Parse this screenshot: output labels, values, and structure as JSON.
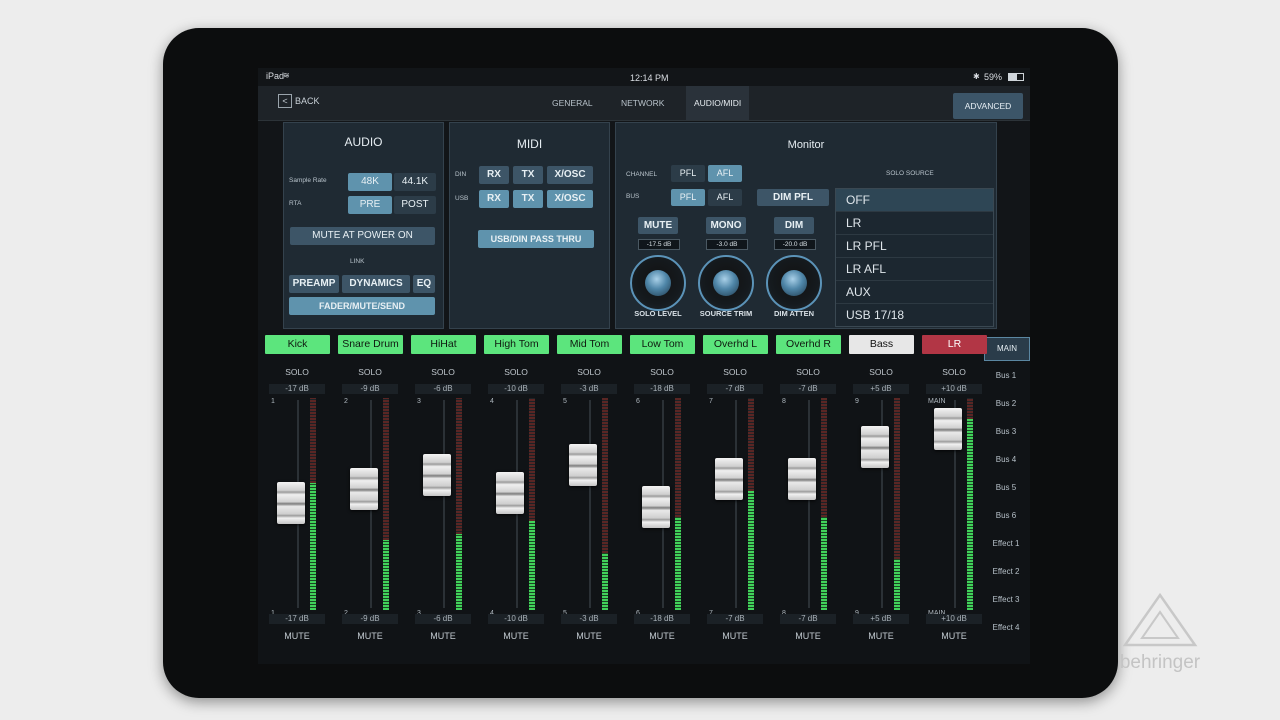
{
  "status_bar": {
    "device": "iPad",
    "time": "12:14 PM",
    "battery": "59%"
  },
  "nav": {
    "back_label": "BACK",
    "tabs": [
      {
        "label": "GENERAL"
      },
      {
        "label": "NETWORK"
      },
      {
        "label": "AUDIO/MIDI"
      }
    ],
    "active_tab": "AUDIO/MIDI",
    "advanced_label": "ADVANCED"
  },
  "audio": {
    "title": "AUDIO",
    "sample_rate_label": "Sample Rate",
    "sample_rate_options": [
      "48K",
      "44.1K"
    ],
    "sample_rate_selected": "48K",
    "rta_label": "RTA",
    "rta_options": [
      "PRE",
      "POST"
    ],
    "rta_selected": "PRE",
    "mute_power_on": "MUTE AT POWER ON",
    "link_label": "LINK",
    "link_buttons": [
      "PREAMP",
      "DYNAMICS",
      "EQ"
    ],
    "fader_mute_send": "FADER/MUTE/SEND"
  },
  "midi": {
    "title": "MIDI",
    "din_label": "DIN",
    "usb_label": "USB",
    "buttons": [
      "RX",
      "TX",
      "X/OSC"
    ],
    "usb_din_pass_thru": "USB/DIN PASS THRU"
  },
  "monitor": {
    "title": "Monitor",
    "channel_label": "CHANNEL",
    "bus_label": "BUS",
    "pfl": "PFL",
    "afl": "AFL",
    "dim_pfl": "DIM PFL",
    "solo_source_label": "SOLO SOURCE",
    "solo_sources": [
      "OFF",
      "LR",
      "LR PFL",
      "LR AFL",
      "AUX",
      "USB 17/18"
    ],
    "solo_source_selected": "OFF",
    "mute_btn": "MUTE",
    "mono_btn": "MONO",
    "dim_btn": "DIM",
    "mute_db": "-17.5 dB",
    "mono_db": "-3.0 dB",
    "dim_db": "-20.0 dB",
    "knobs": [
      "SOLO LEVEL",
      "SOURCE TRIM",
      "DIM ATTEN"
    ]
  },
  "channels": [
    {
      "name": "Kick",
      "color": "#5ce57d",
      "solo": "SOLO",
      "db": "-17 dB",
      "number": "1",
      "mute": "MUTE",
      "fader_level": 0.55,
      "meter_level": 0.6
    },
    {
      "name": "Snare Drum",
      "color": "#5ce57d",
      "solo": "SOLO",
      "db": "-9 dB",
      "number": "2",
      "mute": "MUTE",
      "fader_level": 0.62,
      "meter_level": 0.33
    },
    {
      "name": "HiHat",
      "color": "#5ce57d",
      "solo": "SOLO",
      "db": "-6 dB",
      "number": "3",
      "mute": "MUTE",
      "fader_level": 0.69,
      "meter_level": 0.36
    },
    {
      "name": "High Tom",
      "color": "#5ce57d",
      "solo": "SOLO",
      "db": "-10 dB",
      "number": "4",
      "mute": "MUTE",
      "fader_level": 0.6,
      "meter_level": 0.42
    },
    {
      "name": "Mid Tom",
      "color": "#5ce57d",
      "solo": "SOLO",
      "db": "-3 dB",
      "number": "5",
      "mute": "MUTE",
      "fader_level": 0.74,
      "meter_level": 0.27
    },
    {
      "name": "Low Tom",
      "color": "#5ce57d",
      "solo": "SOLO",
      "db": "-18 dB",
      "number": "6",
      "mute": "MUTE",
      "fader_level": 0.53,
      "meter_level": 0.44
    },
    {
      "name": "Overhd L",
      "color": "#5ce57d",
      "solo": "SOLO",
      "db": "-7 dB",
      "number": "7",
      "mute": "MUTE",
      "fader_level": 0.67,
      "meter_level": 0.56
    },
    {
      "name": "Overhd R",
      "color": "#5ce57d",
      "solo": "SOLO",
      "db": "-7 dB",
      "number": "8",
      "mute": "MUTE",
      "fader_level": 0.67,
      "meter_level": 0.44
    },
    {
      "name": "Bass",
      "color": "#e7e7e7",
      "solo": "SOLO",
      "db": "+5 dB",
      "number": "9",
      "mute": "MUTE",
      "fader_level": 0.83,
      "meter_level": 0.24
    },
    {
      "name": "LR",
      "color": "#b23645",
      "solo": "SOLO",
      "db": "+10 dB",
      "number": "MAIN",
      "mute": "MUTE",
      "fader_level": 0.92,
      "meter_level": 0.9
    }
  ],
  "sidebar": {
    "main": "MAIN",
    "items": [
      "Bus 1",
      "Bus 2",
      "Bus 3",
      "Bus 4",
      "Bus 5",
      "Bus 6",
      "Effect 1",
      "Effect 2",
      "Effect 3",
      "Effect 4"
    ]
  },
  "brand": "behringer"
}
